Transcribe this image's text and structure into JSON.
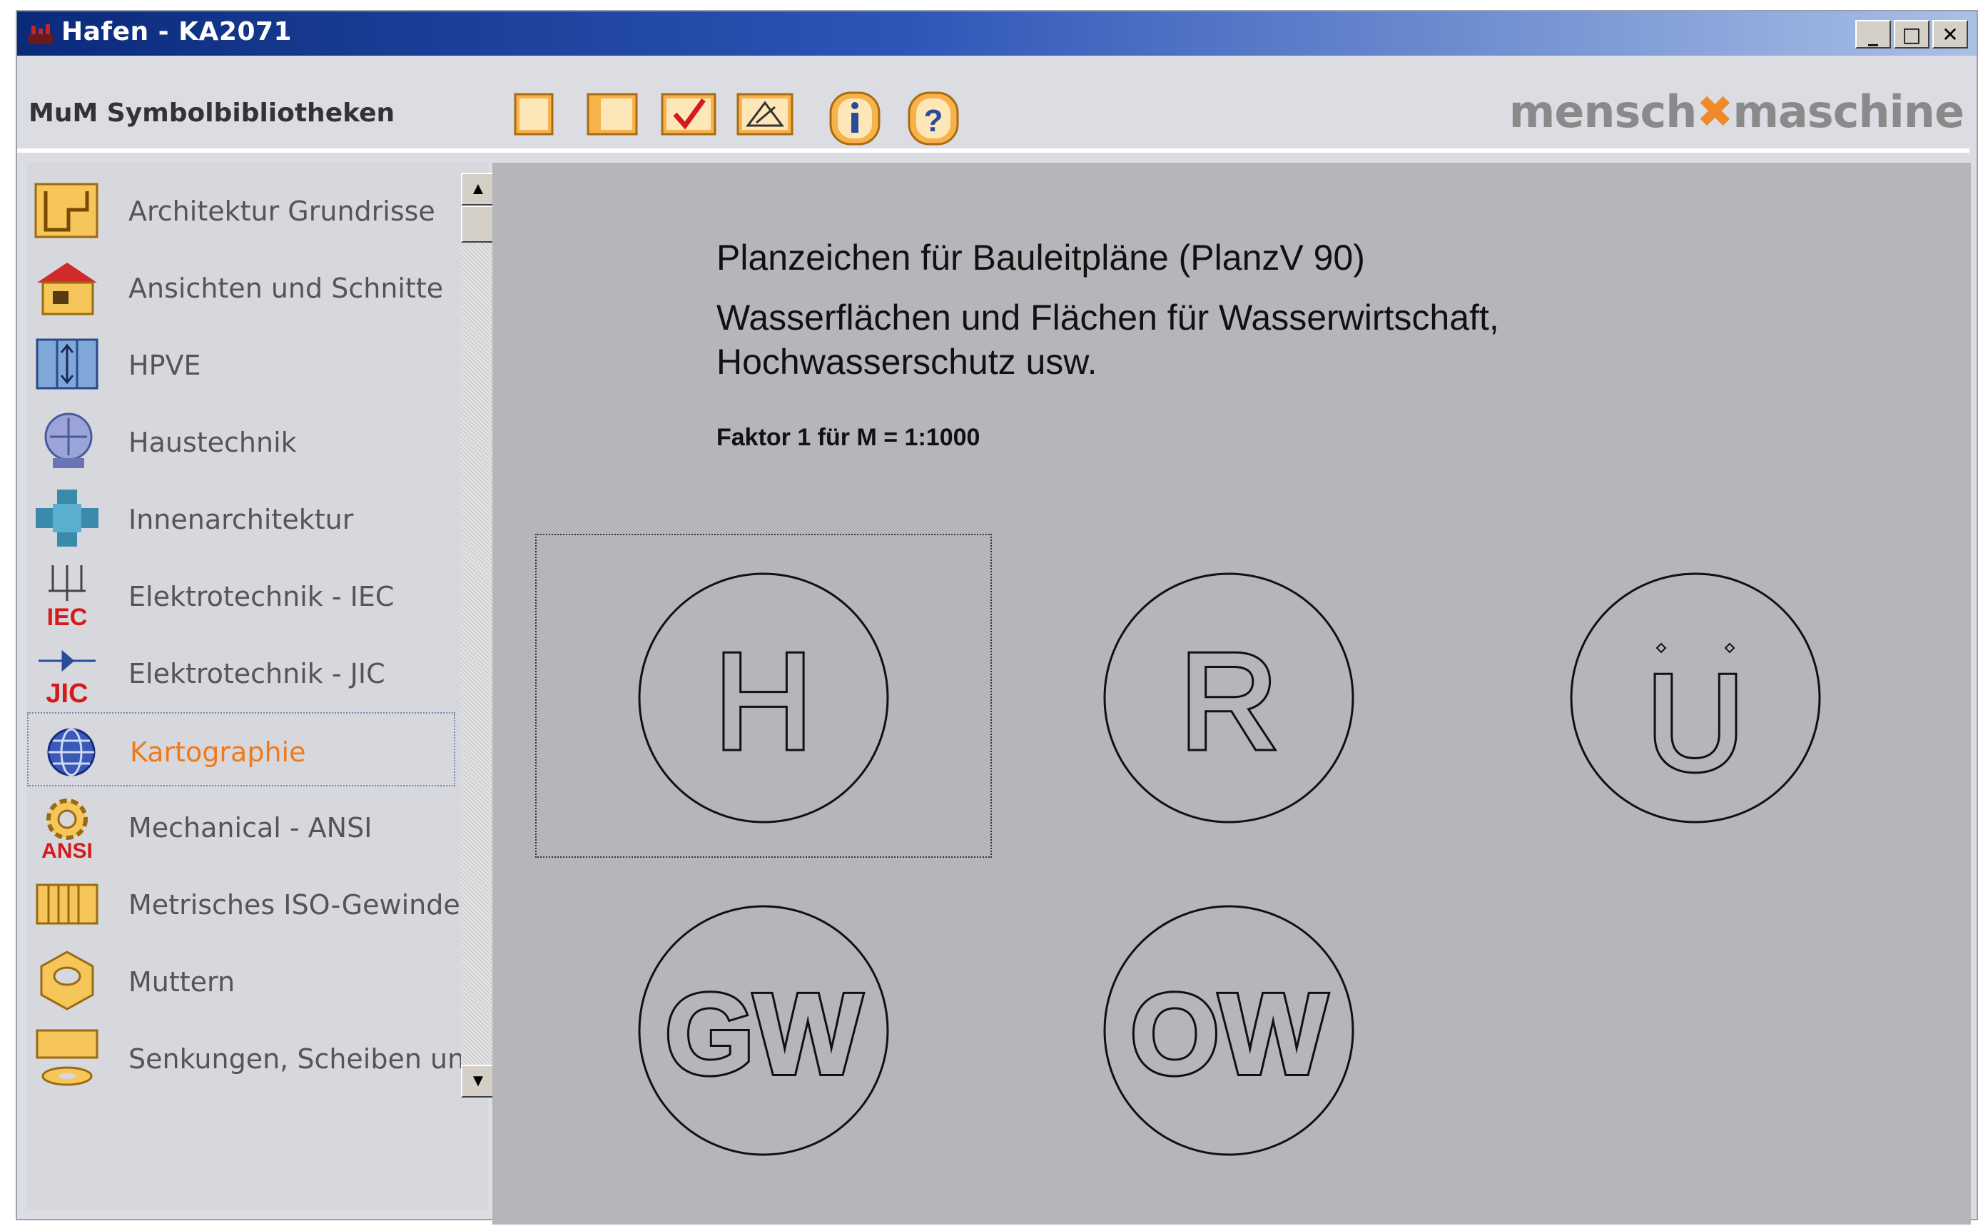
{
  "window": {
    "title": "Hafen  -  KA2071",
    "buttons": [
      "minimize",
      "maximize",
      "close"
    ]
  },
  "appbar": {
    "title": "MuM Symbolbibliotheken",
    "toolbar": [
      "new-page-icon",
      "panel-icon",
      "check-icon",
      "edit-icon",
      "info-icon",
      "help-icon"
    ],
    "brand_left": "mensch",
    "brand_right": "maschine",
    "accent": "#ee8a2a"
  },
  "sidebar": {
    "items": [
      {
        "label": "Architektur Grundrisse",
        "icon": "floorplan-icon"
      },
      {
        "label": "Ansichten und Schnitte",
        "icon": "house-icon"
      },
      {
        "label": "HPVE",
        "icon": "hpve-icon"
      },
      {
        "label": "Haustechnik",
        "icon": "hvac-icon"
      },
      {
        "label": "Innenarchitektur",
        "icon": "interior-icon"
      },
      {
        "label": "Elektrotechnik - IEC",
        "icon": "iec-icon",
        "badge": "IEC"
      },
      {
        "label": "Elektrotechnik - JIC",
        "icon": "jic-icon",
        "badge": "JIC"
      },
      {
        "label": "Kartographie",
        "icon": "globe-icon",
        "selected": true
      },
      {
        "label": "Mechanical - ANSI",
        "icon": "gear-icon",
        "badge": "ANSI"
      },
      {
        "label": "Metrisches ISO-Gewinde",
        "icon": "thread-icon"
      },
      {
        "label": "Muttern",
        "icon": "nut-icon"
      },
      {
        "label": "Senkungen, Scheiben und Du",
        "icon": "washer-icon"
      }
    ],
    "selected_color": "#f07a1a"
  },
  "content": {
    "heading": "Planzeichen für Bauleitpläne (PlanzV 90)",
    "subheading_line1": "Wasserflächen und Flächen für Wasserwirtschaft,",
    "subheading_line2": "Hochwasserschutz usw.",
    "factor": "Faktor 1 für M = 1:1000",
    "symbols": [
      {
        "letters": "H",
        "selected": true
      },
      {
        "letters": "R"
      },
      {
        "letters": "U",
        "umlaut": true
      },
      {
        "letters": "GW"
      },
      {
        "letters": "OW"
      }
    ]
  }
}
